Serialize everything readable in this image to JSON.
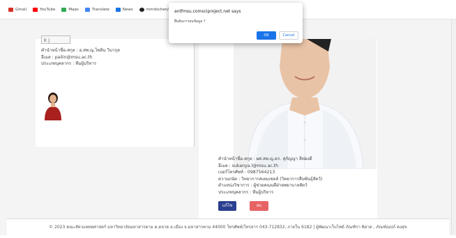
{
  "bookmarks": [
    {
      "label": "Gmail",
      "icon": "gmail-icon",
      "color": "#d93025"
    },
    {
      "label": "YouTube",
      "icon": "youtube-icon",
      "color": "#ff0000"
    },
    {
      "label": "Maps",
      "icon": "maps-icon",
      "color": "#34a853"
    },
    {
      "label": "Translate",
      "icon": "translate-icon",
      "color": "#4285f4"
    },
    {
      "label": "News",
      "icon": "news-icon",
      "color": "#1a73e8"
    },
    {
      "label": "mmdschen/php-cr...",
      "icon": "github-icon",
      "color": "#222222"
    }
  ],
  "dialog": {
    "title": "antfmsu.comsciproject.net says",
    "message": "ยืนยันการลบข้อมูล ?",
    "ok_label": "OK",
    "cancel_label": "Cancel"
  },
  "left_profile": {
    "input_value": "k  j",
    "name_line": "คำนำหน้าชื่อ-สกุล : อ.สพ.ญ.ไพลิน วิบากุล",
    "email_line": "อีเมล : pailin@msu.ac.th",
    "type_line": "ประเภทบุคลากร : ทีมผู้บริหาร"
  },
  "right_profile": {
    "name_line": "คำนำหน้าชื่อ-สกุล : ผศ.สพ.ญ.ดร. สุกัญญา ลีทองดี",
    "email_line": "อีเมล : sukanya.l@msu.ac.th",
    "phone_line": "เบอร์โทรศัพท์ : 0987564213",
    "expertise_line": "ความถนัด : วิทยาการสเตมเซลล์ (วิทยาการสืบพันธุ์สัตว์)",
    "position_line": "ตำแหน่งวิชาการ : ผู้ช่วยคณบดีฝ่ายพยาบาลสัตว์",
    "type_line": "ประเภทบุคลากร : ทีมผู้บริหาร",
    "edit_label": "แก้ไข",
    "delete_label": "ลบ"
  },
  "footer": {
    "text": "© 2023 คณะสัตวแพทยศาสตร์ มหาวิทยาลัยมหาสารคาม ต.ตลาด อ.เมือง จ.มหาสารคาม 44000 โทรศัพท์/โทรสาร 043-712832, ภายใน 6182 | ผู้พัฒนาเว็บไซต์ ภัณฑิรา พิลาด , ภัณฑ์ณปภ์ คงสุข"
  },
  "colors": {
    "edit_button": "#2a3f8f",
    "delete_button": "#e76464",
    "ok_button": "#1a73e8"
  }
}
